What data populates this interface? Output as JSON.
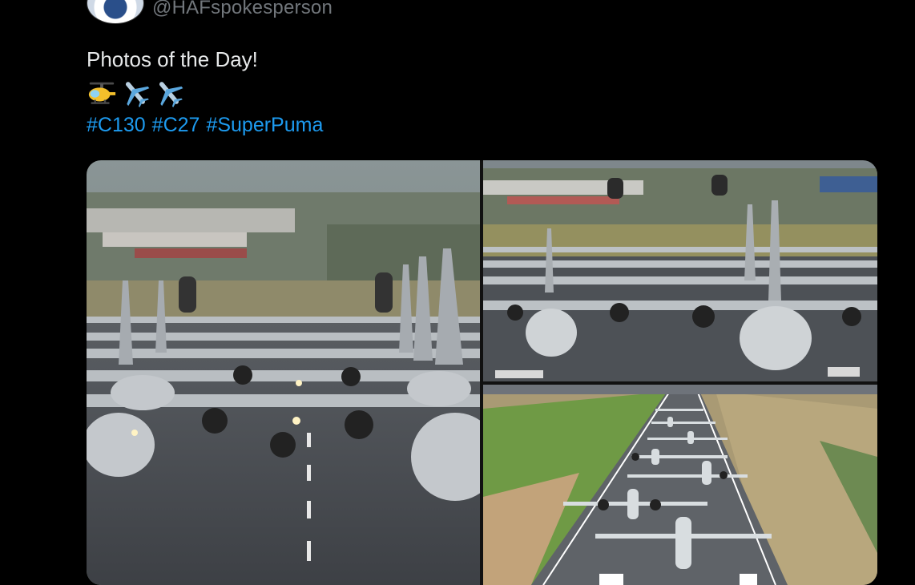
{
  "tweet": {
    "handle": "@HAFspokesperson",
    "text": "Photos of the Day!",
    "emojis": [
      "helicopter-emoji",
      "airplane-emoji",
      "airplane-emoji"
    ],
    "hashtags": [
      "#C130",
      "#C27",
      "#SuperPuma"
    ]
  },
  "media": {
    "photos": [
      {
        "subject": "C-130 transports and Super Puma helicopters lined up on a runway"
      },
      {
        "subject": "Aircraft formation on runway with helicopters hovering"
      },
      {
        "subject": "Aerial view of aircraft lined up along the runway"
      }
    ]
  },
  "colors": {
    "background": "#000000",
    "text": "#e7e9ea",
    "handle": "#71767b",
    "hashtag": "#1d9bf0"
  }
}
